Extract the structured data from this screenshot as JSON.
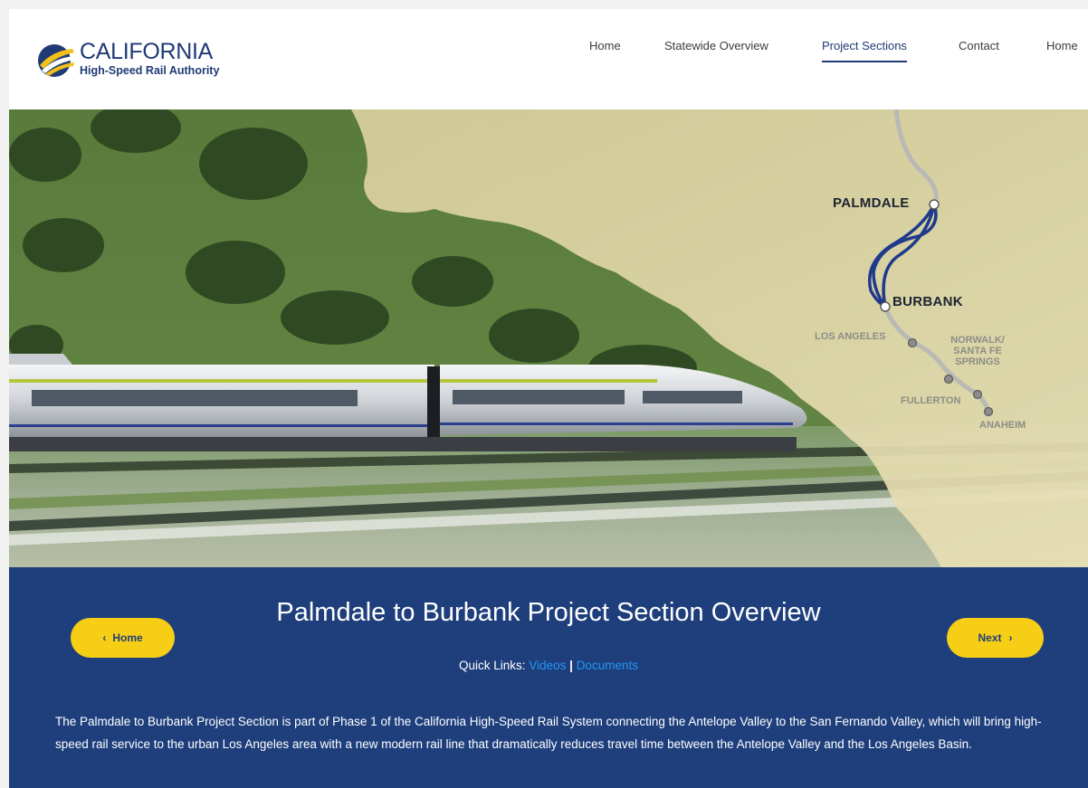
{
  "header": {
    "logo": {
      "title": "CALIFORNIA",
      "subtitle": "High-Speed Rail Authority",
      "icon": "california-hsr-logo"
    },
    "nav": [
      {
        "label": "Home",
        "active": false
      },
      {
        "label": "Statewide Overview",
        "active": false
      },
      {
        "label": "Project Sections",
        "active": true
      },
      {
        "label": "Contact",
        "active": false
      },
      {
        "label": "Home",
        "active": false
      }
    ]
  },
  "hero": {
    "map_labels": {
      "palmdale": "PALMDALE",
      "burbank": "BURBANK",
      "los_angeles": "LOS ANGELES",
      "norwalk": "NORWALK/",
      "santa_fe": "SANTA FE",
      "springs": "SPRINGS",
      "fullerton": "FULLERTON",
      "anaheim": "ANAHEIM"
    }
  },
  "section": {
    "title": "Palmdale to Burbank Project Section Overview",
    "quick_links_label": "Quick Links:",
    "quick_links": {
      "videos": "Videos",
      "separator": "|",
      "documents": "Documents"
    },
    "home_button": "Home",
    "home_chevron": "‹",
    "next_button": "Next",
    "next_chevron": "›",
    "body": "The Palmdale to Burbank Project Section is part of Phase 1 of the California High-Speed Rail System connecting the Antelope Valley to the San Fernando Valley, which will bring high-speed rail service to the urban Los Angeles area with a new modern rail line that dramatically reduces travel time between the Antelope Valley and the Los Angeles Basin."
  },
  "colors": {
    "brand_blue": "#1e3f7c",
    "button_yellow": "#f7ce16",
    "link_blue": "#2196f3",
    "map_route": "#1f3a8a"
  }
}
